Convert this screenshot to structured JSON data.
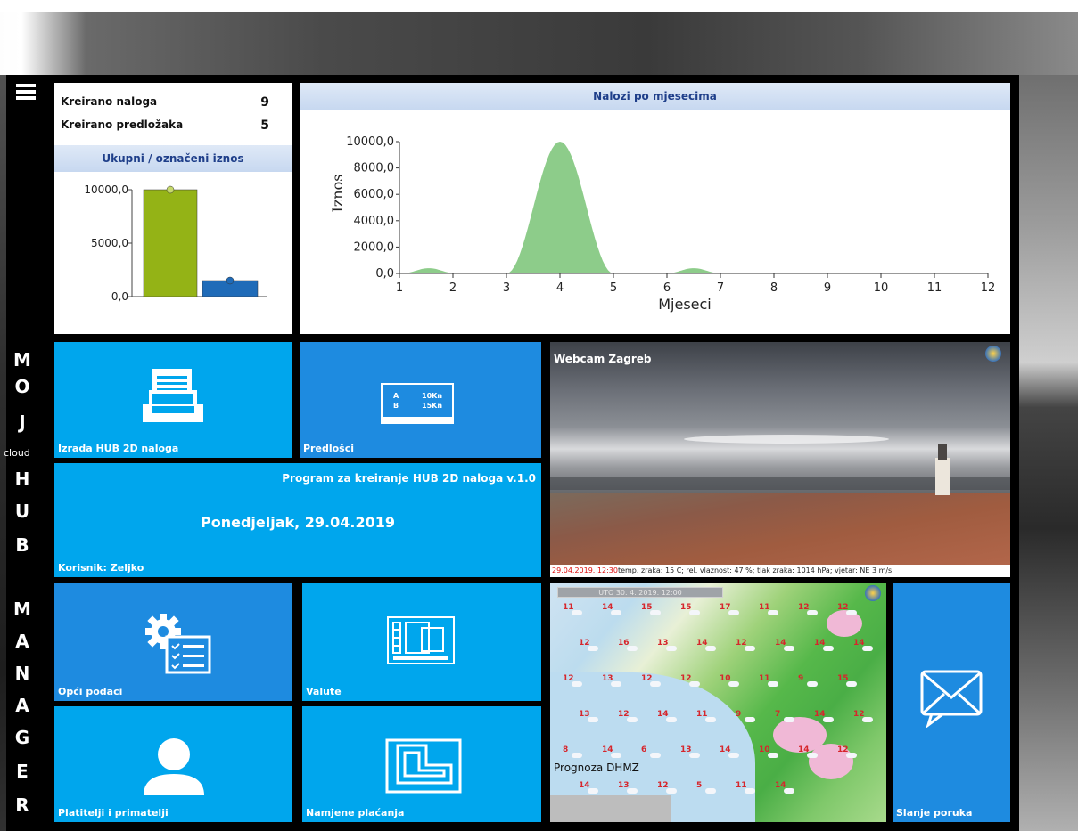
{
  "sidebar": {
    "brand_top": [
      "M",
      "O",
      "J"
    ],
    "brand_small": "cloud",
    "brand_mid": [
      "H",
      "U",
      "B"
    ],
    "brand_bottom": [
      "M",
      "A",
      "N",
      "A",
      "G",
      "E",
      "R"
    ]
  },
  "summary": {
    "rows": [
      {
        "label": "Kreirano naloga",
        "value": "9"
      },
      {
        "label": "Kreirano predložaka",
        "value": "5"
      }
    ],
    "section_title": "Ukupni / označeni iznos"
  },
  "chart_data": [
    {
      "type": "bar",
      "title": "Ukupni / označeni iznos",
      "categories": [
        "",
        ""
      ],
      "values": [
        10000,
        1500
      ],
      "colors": [
        "#94b316",
        "#1f6bb8"
      ],
      "ylim": [
        0,
        10000
      ],
      "yticks": [
        "0,0",
        "5000,0",
        "10000,0"
      ]
    },
    {
      "type": "area",
      "title": "Nalozi po mjesecima",
      "xlabel": "Mjeseci",
      "ylabel": "Iznos",
      "x": [
        1,
        2,
        3,
        4,
        5,
        6,
        7,
        8,
        9,
        10,
        11,
        12
      ],
      "ylim": [
        0,
        10000
      ],
      "yticks": [
        "0,0",
        "2000,0",
        "4000,0",
        "6000,0",
        "8000,0",
        "10000,0"
      ],
      "peaks": [
        {
          "center": 1.55,
          "halfwidth": 0.5,
          "value": 400
        },
        {
          "center": 4.0,
          "halfwidth": 1.0,
          "value": 10000
        },
        {
          "center": 6.5,
          "halfwidth": 0.5,
          "value": 400
        }
      ],
      "color": "#8dcc8a"
    }
  ],
  "tiles": {
    "izrada": "Izrada HUB 2D naloga",
    "predlosci": "Predlošci",
    "program_title": "Program za kreiranje HUB 2D naloga v.1.0",
    "date": "Ponedjeljak, 29.04.2019",
    "user": "Korisnik: Zeljko",
    "opci": "Opći podaci",
    "valute": "Valute",
    "platitelji": "Platitelji i primatelji",
    "namjene": "Namjene plaćanja",
    "slanje": "Slanje poruka",
    "predlosci_a": "A",
    "predlosci_b": "B",
    "predlosci_a_val": "10Kn",
    "predlosci_b_val": "15Kn"
  },
  "webcam": {
    "title": "Webcam Zagreb",
    "caption_date": "29.04.2019. 12:30",
    "caption_text": "temp. zraka: 15 C; rel. vlaznost: 47 %; tlak zraka: 1014 hPa; vjetar: NE 3 m/s"
  },
  "forecast": {
    "date": "UTO 30. 4. 2019. 12:00",
    "title": "Prognoza DHMZ",
    "temps": [
      "11",
      "14",
      "15",
      "15",
      "17",
      "11",
      "12",
      "12",
      "12",
      "16",
      "13",
      "14",
      "12",
      "14",
      "14",
      "14",
      "12",
      "13",
      "12",
      "12",
      "10",
      "11",
      "9",
      "15",
      "13",
      "12",
      "14",
      "11",
      "9",
      "7",
      "14",
      "12",
      "8",
      "14",
      "6",
      "13",
      "14",
      "10",
      "14",
      "12",
      "14",
      "13",
      "12",
      "5",
      "11",
      "14"
    ]
  }
}
